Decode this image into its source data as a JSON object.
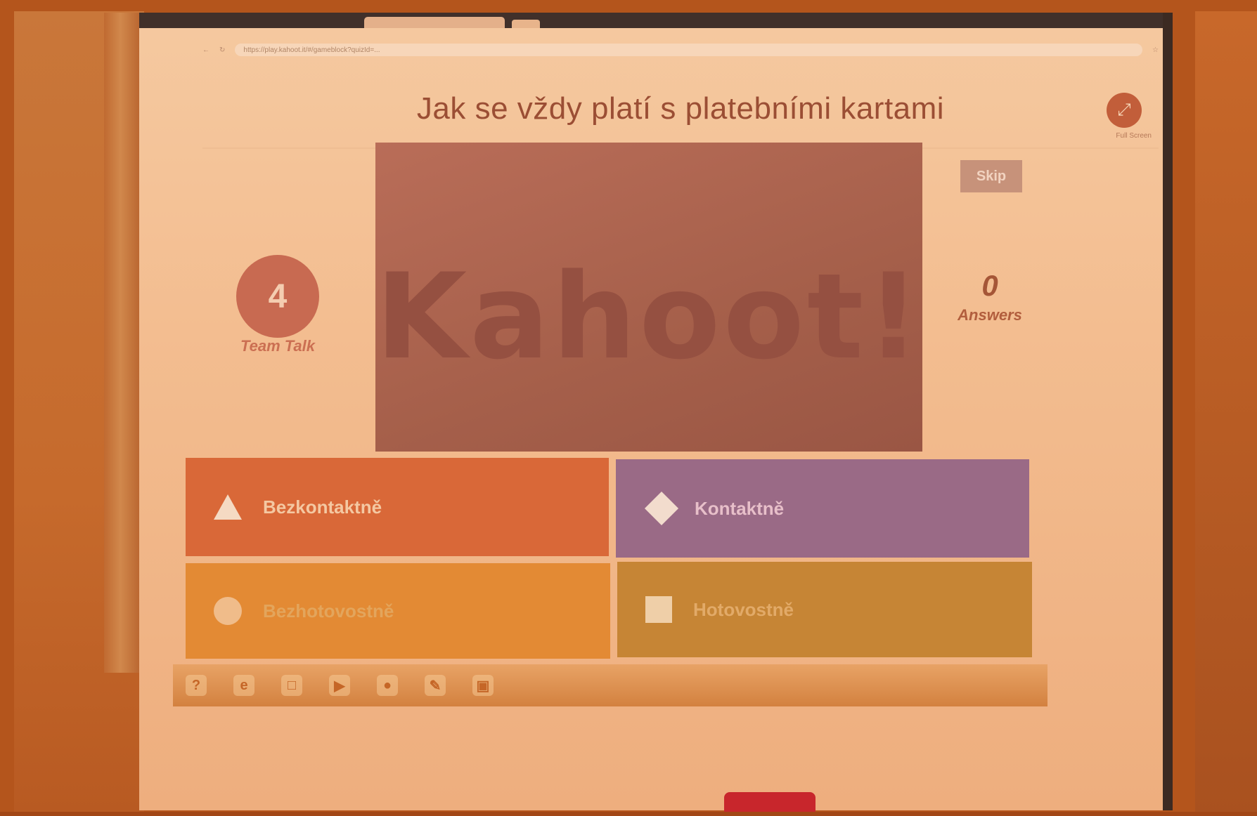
{
  "browser": {
    "address": "https://play.kahoot.it/#/gameblock?quizId=..."
  },
  "question": {
    "title": "Jak se vždy platí s platebními kartami"
  },
  "media": {
    "logo_text": "Kahoot!"
  },
  "timer": {
    "value": "4",
    "label": "Team Talk"
  },
  "controls": {
    "skip_label": "Skip",
    "fullscreen_label": "Full Screen"
  },
  "answers_counter": {
    "count": "0",
    "label": "Answers"
  },
  "answers": [
    {
      "text": "Bezkontaktně",
      "shape": "triangle-icon",
      "color": "#d96838"
    },
    {
      "text": "Kontaktně",
      "shape": "diamond-icon",
      "color": "#9a6a86"
    },
    {
      "text": "Bezhotovostně",
      "shape": "circle-icon",
      "color": "#e38a34"
    },
    {
      "text": "Hotovostně",
      "shape": "square-icon",
      "color": "#c68535"
    }
  ],
  "taskbar": {
    "icons": [
      "help-icon",
      "internet-explorer-icon",
      "file-explorer-icon",
      "media-player-icon",
      "chrome-icon",
      "paint-icon",
      "camera-icon"
    ]
  }
}
